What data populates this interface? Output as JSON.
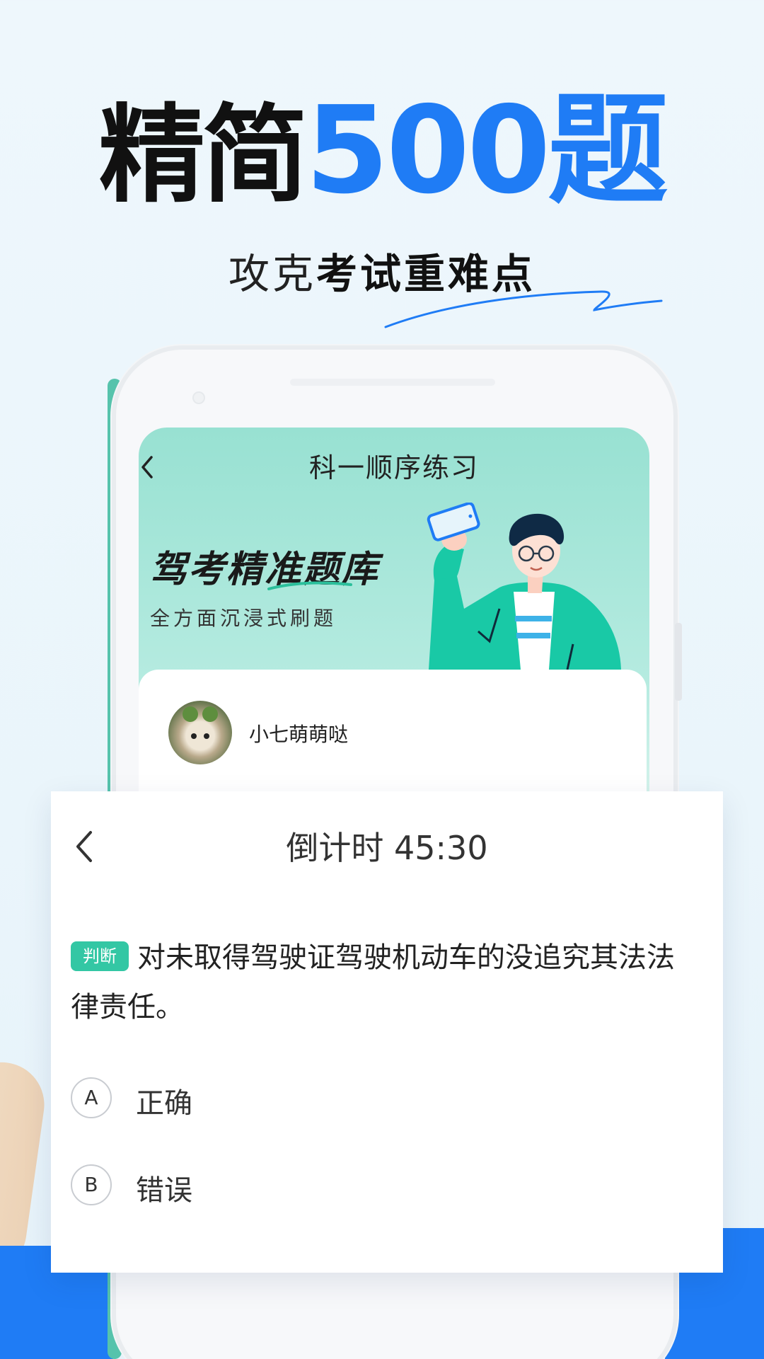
{
  "hero": {
    "title_black": "精简",
    "title_blue": "500题",
    "subtitle_plain": "攻克",
    "subtitle_strong": "考试重难点"
  },
  "phone_screen": {
    "title": "科一顺序练习",
    "banner_title": "驾考精准题库",
    "banner_subtitle": "全方面沉浸式刷题",
    "username": "小七萌萌哒"
  },
  "quiz": {
    "timer_label": "倒计时 45:30",
    "tag": "判断",
    "question": "对未取得驾驶证驾驶机动车的没追究其法法律责任。",
    "options": [
      {
        "letter": "A",
        "text": "正确"
      },
      {
        "letter": "B",
        "text": "错误"
      }
    ]
  },
  "colors": {
    "accent_blue": "#1f7cf5",
    "tag_green": "#33c7a4",
    "banner_teal": "#98e1d2"
  },
  "icons": [
    "back-chevron-icon",
    "phone-in-hand-illustration",
    "avatar-cat-image"
  ]
}
